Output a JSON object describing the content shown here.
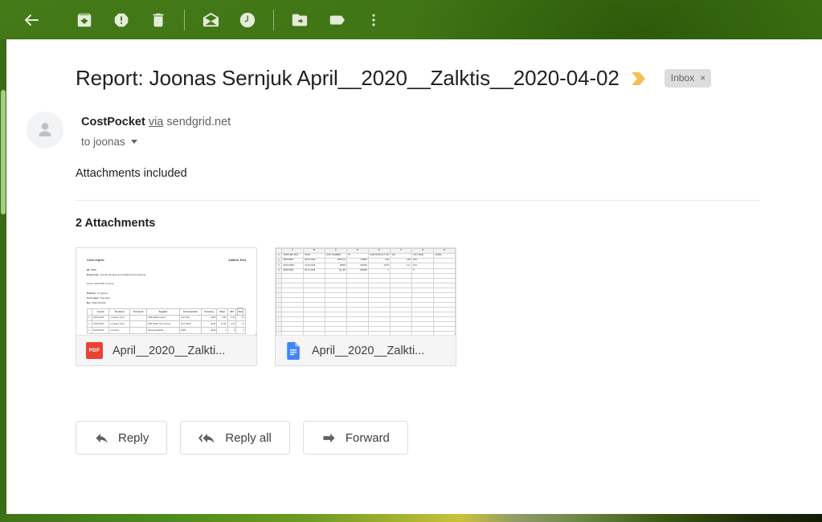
{
  "window": {
    "background_color": "#3e7016",
    "pane_background": "#ffffff"
  },
  "toolbar": {
    "icons": [
      {
        "name": "back-arrow-icon",
        "label": "Back to Inbox"
      },
      {
        "name": "archive-icon",
        "label": "Archive"
      },
      {
        "name": "report-spam-icon",
        "label": "Report spam"
      },
      {
        "name": "delete-trash-icon",
        "label": "Delete"
      },
      {
        "name": "mark-unread-icon",
        "label": "Mark as unread"
      },
      {
        "name": "snooze-clock-icon",
        "label": "Snooze"
      },
      {
        "name": "move-to-folder-icon",
        "label": "Move to"
      },
      {
        "name": "label-tag-icon",
        "label": "Labels"
      },
      {
        "name": "more-options-icon",
        "label": "More"
      }
    ]
  },
  "email": {
    "subject": "Report: Joonas Sernjuk April__2020__Zalktis__2020-04-02",
    "important_marker": "important-marker-icon",
    "label_chip": {
      "text": "Inbox",
      "remove": "×"
    },
    "sender": {
      "avatar": "default-person-avatar",
      "name": "CostPocket",
      "via": "via",
      "domain": "sendgrid.net",
      "recipient": "to joonas"
    },
    "body": "Attachments included"
  },
  "attachments": {
    "heading": "2 Attachments",
    "items": [
      {
        "name": "April__2020__Zalkti...",
        "type": "pdf",
        "badge_text": "PDF",
        "badge_color": "#ea4335",
        "fold_color": "#ea4335",
        "icon": "pdf-file-icon"
      },
      {
        "name": "April__2020__Zalkti...",
        "type": "sheet",
        "badge_text": "",
        "badge_color": "#4285f4",
        "fold_color": "#4285f4",
        "icon": "google-docs-file-icon"
      }
    ]
  },
  "pdf_preview": {
    "title": "Cost report",
    "brand": "Zalktis Test",
    "fields": [
      {
        "key": "ID:",
        "value": "5385"
      },
      {
        "key": "Export by:",
        "value": "Joonas Sernjuk (joonas@unicost.finance)"
      }
    ],
    "note_label": "Issue:",
    "note_value": "April PDF (1 item)",
    "paid_by_label": "Paid by:",
    "paid_by_value": "Company",
    "cost_type_label": "Cost type:",
    "cost_type_value": "Transport",
    "ref_label": "No:",
    "ref_value": "2020-04-001",
    "columns": [
      "",
      "Issued",
      "Posted in",
      "Comment",
      "Supplier",
      "Document No",
      "Currency",
      "Value",
      "VAT",
      "Sum"
    ],
    "rows": [
      [
        "1",
        "01/04/2020",
        "company card",
        "",
        "UAB Zalktis Laisve",
        "AXT-184",
        "EUR",
        "5.82",
        "0.45",
        "6.4"
      ],
      [
        "2",
        "13/01/2020",
        "company card",
        "",
        "UAB 'Baltic Taxi' Lietuva",
        "AXT-3454",
        "EUR",
        "14.35",
        "3.47",
        "17"
      ],
      [
        "3",
        "16/06/2020",
        "company",
        "",
        "Siguapsaeldidas",
        "9680",
        "EUR",
        "4",
        "0",
        "4"
      ]
    ]
  },
  "sheet_preview": {
    "column_letters": [
      "A",
      "B",
      "C",
      "D",
      "E",
      "F",
      "G",
      "H"
    ],
    "row_numbers": [
      "1",
      "2",
      "3",
      "4"
    ],
    "header_row": [
      "SUPPLIER REG",
      "DATE",
      "DOC NUMBER",
      "ID",
      "SUM WITHOUT VAT",
      "VAT",
      "VAT CODE",
      "COMM"
    ],
    "rows": [
      [
        "300034984",
        "28.03.2018",
        "265*1C2",
        "LT9845",
        "1.82",
        "0.38",
        "R21",
        ""
      ],
      [
        "3HSCC0841",
        "13.03.2018",
        "18528",
        "DI4055",
        "16.55",
        "3.17",
        "R21",
        ""
      ],
      [
        "400021993",
        "05.12.2018",
        "SQ_88",
        "D16055",
        "2",
        "",
        "P",
        ""
      ]
    ]
  },
  "actions": [
    {
      "label": "Reply",
      "icon": "reply-arrow-icon"
    },
    {
      "label": "Reply all",
      "icon": "reply-all-arrow-icon"
    },
    {
      "label": "Forward",
      "icon": "forward-arrow-icon"
    }
  ],
  "colors": {
    "accent_green": "#3e7016",
    "pdf_red": "#ea4335",
    "docs_blue": "#4285f4",
    "marker_yellow": "#f2c14e",
    "text_primary": "#202124",
    "text_secondary": "#5f6368"
  }
}
